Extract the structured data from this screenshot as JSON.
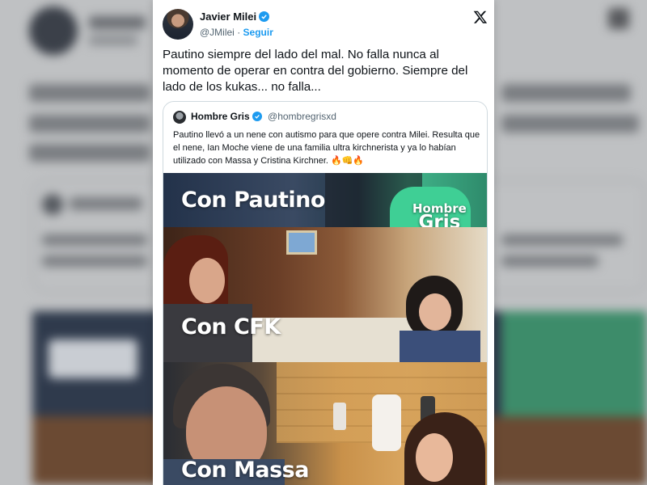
{
  "tweet": {
    "author_name": "Javier Milei",
    "handle": "@JMilei",
    "separator": "·",
    "follow_label": "Seguir",
    "text": "Pautino siempre del lado del mal. No falla nunca al momento de operar en contra del gobierno. Siempre del lado de los kukas... no falla..."
  },
  "quoted": {
    "author_name": "Hombre Gris",
    "handle": "@hombregrisxd",
    "text": "Pautino llevó a un nene con autismo para  que opere contra Milei. Resulta que el nene, Ian Moche viene de una familia ultra kirchnerista y ya lo habían utilizado con Massa y Cristina Kirchner. 🔥👊🔥",
    "panels": [
      {
        "label": "Con Pautino"
      },
      {
        "label": "Con CFK"
      },
      {
        "label": "Con Massa"
      }
    ],
    "watermark_line1": "Hombre",
    "watermark_line2": "Gris"
  },
  "colors": {
    "verified_blue": "#1d9bf0",
    "text_primary": "#0f1419",
    "text_secondary": "#536471",
    "border": "#cfd9de"
  },
  "icons": [
    "verified-badge-icon",
    "x-logo-icon"
  ]
}
